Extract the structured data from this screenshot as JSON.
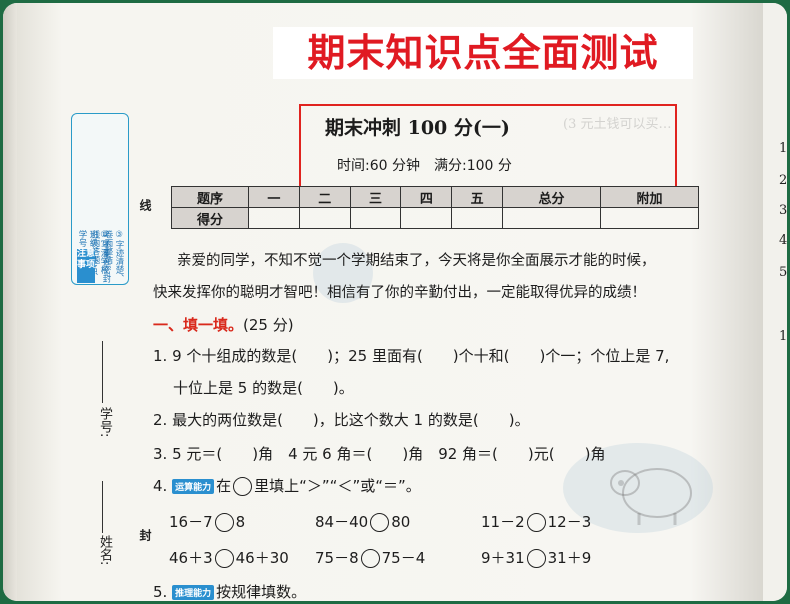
{
  "banner": {
    "title": "期末知识点全面测试"
  },
  "exam": {
    "title": "期末冲刺 100 分(一)",
    "info": "时间:60 分钟　满分:100 分"
  },
  "notice": {
    "tab": "注意事项",
    "lines": [
      "①写清学校、班级、姓名、学号",
      "②不要在密封线内答题",
      "③字迹清楚、卷面整洁"
    ]
  },
  "binding": {
    "line_char": "线",
    "seal_char": "封",
    "student_no_label": "学号:",
    "name_label": "姓名:"
  },
  "score_table": {
    "row1_label": "题序",
    "row2_label": "得分",
    "headers": [
      "一",
      "二",
      "三",
      "四",
      "五",
      "总分",
      "附加"
    ]
  },
  "intro": {
    "line1": "亲爱的同学，不知不觉一个学期结束了，今天将是你全面展示才能的时候，",
    "line2": "快来发挥你的聪明才智吧！相信有了你的辛勤付出，一定能取得优异的成绩！"
  },
  "section1": {
    "title": "一、填一填。",
    "score": "(25 分)"
  },
  "questions": {
    "q1_line1": "1. 9 个十组成的数是(　　)；25 里面有(　　)个十和(　　)个一；个位上是 7,",
    "q1_line2": "十位上是 5 的数是(　　)。",
    "q2": "2. 最大的两位数是(　　)，比这个数大 1 的数是(　　)。",
    "q3": "3. 5 元＝(　　)角　4 元 6 角＝(　　)角　92 角＝(　　)元(　　)角",
    "q4_num": "4.",
    "q4_tag": "运算能力",
    "q4_pre": "在",
    "q4_post": "里填上“＞”“＜”或“＝”。",
    "q5_num": "5.",
    "q5_tag": "推理能力",
    "q5_text": "按规律填数。"
  },
  "compare": [
    {
      "left": "16－7",
      "right": "8"
    },
    {
      "left": "84－40",
      "right": "80"
    },
    {
      "left": "11－2",
      "right": "12－3"
    },
    {
      "left": "46＋3",
      "right": "46＋30"
    },
    {
      "left": "75－8",
      "right": "75－4"
    },
    {
      "left": "9＋31",
      "right": "31＋9"
    }
  ],
  "right_page_numbers": [
    "1",
    "2",
    "3",
    "4",
    "5",
    "1"
  ]
}
